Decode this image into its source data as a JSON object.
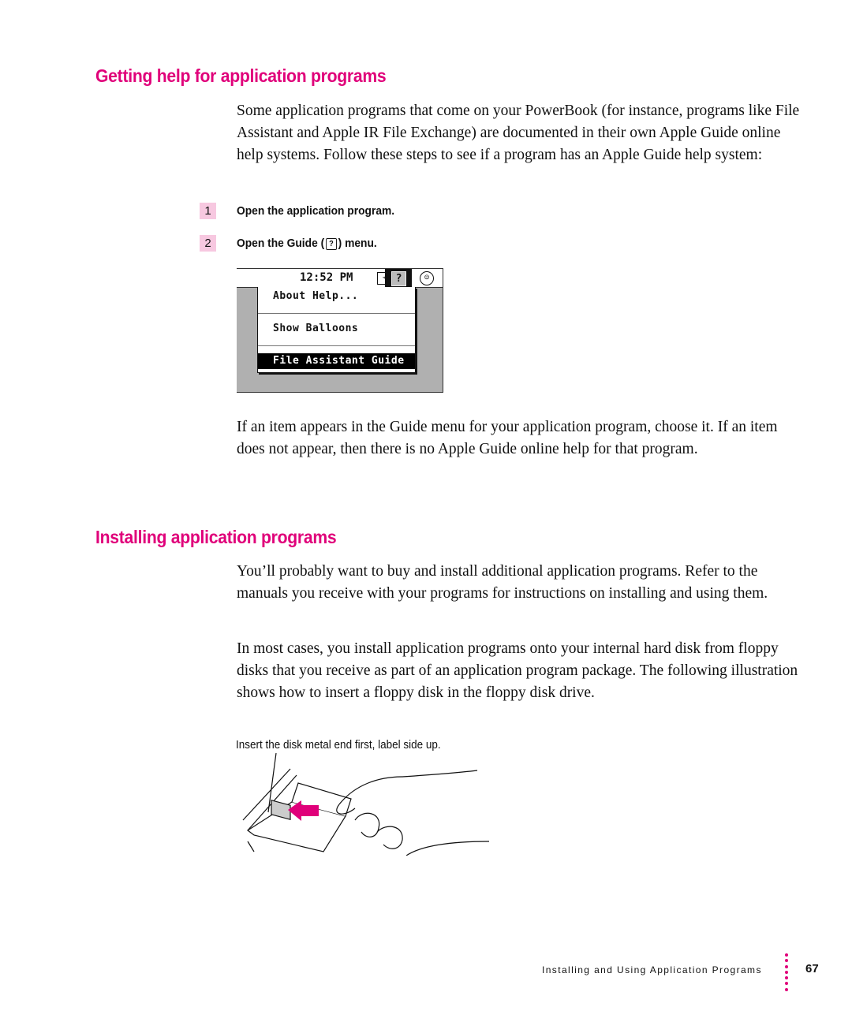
{
  "section1": {
    "heading": "Getting help for application programs",
    "intro": "Some application programs that come on your PowerBook (for instance, programs like File Assistant and Apple IR File Exchange) are documented in their own Apple Guide online help systems. Follow these steps to see if a program has an Apple Guide help system:",
    "steps": [
      {
        "number": "1",
        "text": "Open the application program."
      },
      {
        "number": "2",
        "text_before": "Open the Guide (",
        "icon": "?",
        "text_after": ") menu."
      }
    ],
    "screenshot": {
      "clock": "12:52 PM",
      "battery_icon": "⌁",
      "guide_icon": "?",
      "app_icon": "☺",
      "menu_items": [
        "About Help...",
        "Show Balloons",
        "File Assistant Guide"
      ],
      "selected_item": "File Assistant Guide"
    },
    "after": "If an item appears in the Guide menu for your application program, choose it. If an item does not appear, then there is no Apple Guide online help for that program."
  },
  "section2": {
    "heading": "Installing application programs",
    "paragraphs": [
      "You’ll probably want to buy and install additional application programs. Refer to the manuals you receive with your programs for instructions on installing and using them.",
      "In most cases, you install application programs onto your internal hard disk from floppy disks that you receive as part of an application program package. The following illustration shows how to insert a floppy disk in the floppy disk drive."
    ],
    "illustration_caption": "Insert the disk metal end first, label side up."
  },
  "footer": {
    "chapter_title": "Installing and Using Application Programs",
    "page_number": "67"
  },
  "colors": {
    "accent": "#e0007a",
    "step_badge": "#f7c8e0"
  }
}
